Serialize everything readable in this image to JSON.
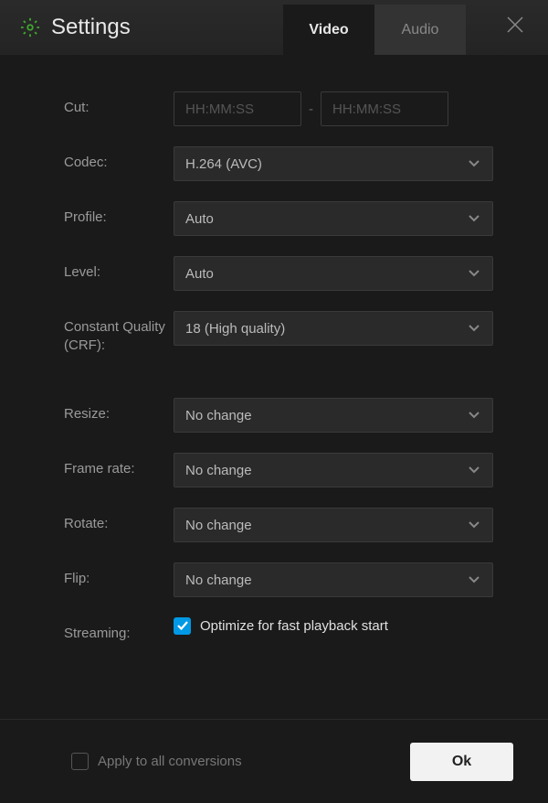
{
  "header": {
    "title": "Settings",
    "tabs": {
      "video": "Video",
      "audio": "Audio"
    }
  },
  "form": {
    "cut": {
      "label": "Cut:",
      "start_placeholder": "HH:MM:SS",
      "end_placeholder": "HH:MM:SS",
      "separator": "-"
    },
    "codec": {
      "label": "Codec:",
      "value": "H.264 (AVC)"
    },
    "profile": {
      "label": "Profile:",
      "value": "Auto"
    },
    "level": {
      "label": "Level:",
      "value": "Auto"
    },
    "crf": {
      "label": "Constant Quality (CRF):",
      "value": "18 (High quality)"
    },
    "resize": {
      "label": "Resize:",
      "value": "No change"
    },
    "framerate": {
      "label": "Frame rate:",
      "value": "No change"
    },
    "rotate": {
      "label": "Rotate:",
      "value": "No change"
    },
    "flip": {
      "label": "Flip:",
      "value": "No change"
    },
    "streaming": {
      "label": "Streaming:",
      "checkbox_label": "Optimize for fast playback start"
    }
  },
  "footer": {
    "apply_all_label": "Apply to all conversions",
    "ok_label": "Ok"
  }
}
